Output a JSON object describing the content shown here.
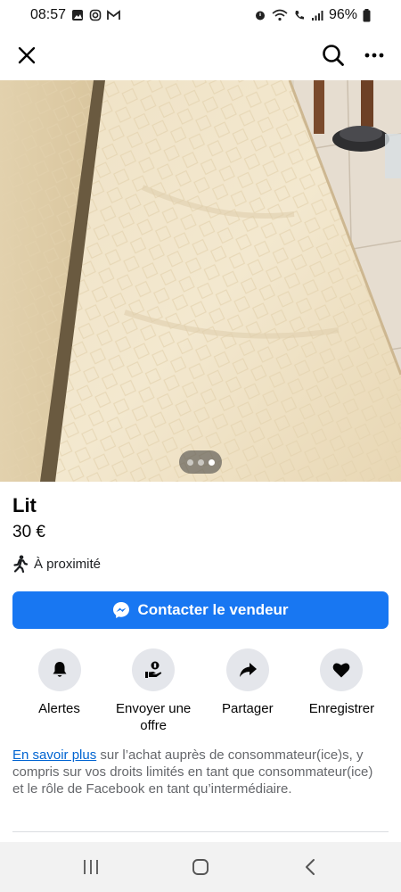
{
  "status_bar": {
    "time": "08:57",
    "battery": "96%"
  },
  "header": {
    "close_icon": "close-icon",
    "search_icon": "search-icon",
    "more_icon": "more-icon"
  },
  "photo": {
    "page_index": 3,
    "page_count": 3
  },
  "listing": {
    "title": "Lit",
    "price": "30 €",
    "proximity": "À proximité"
  },
  "contact_button": {
    "label": "Contacter le vendeur",
    "color": "#1877f2"
  },
  "actions": [
    {
      "label": "Alertes",
      "icon": "bell-icon"
    },
    {
      "label": "Envoyer une offre",
      "icon": "offer-icon"
    },
    {
      "label": "Partager",
      "icon": "share-icon"
    },
    {
      "label": "Enregistrer",
      "icon": "heart-icon"
    }
  ],
  "info": {
    "link": "En savoir plus",
    "text": " sur l’achat auprès de consommateur(ice)s, y compris sur vos droits limités en tant que consommateur(ice) et le rôle de Facebook en tant qu’intermédiaire."
  },
  "colors": {
    "accent": "#1877f2",
    "link": "#0064d1"
  }
}
